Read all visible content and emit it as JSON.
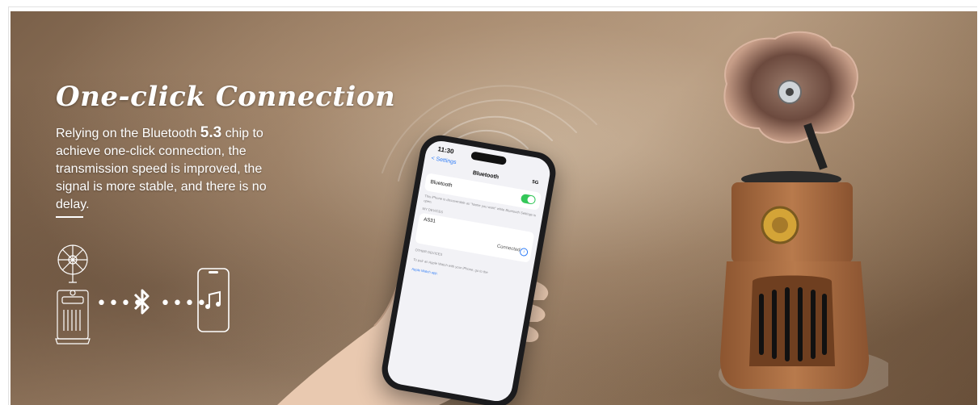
{
  "banner": {
    "headline": "One-click Connection",
    "desc_prefix": "Relying on the Bluetooth ",
    "desc_version": "5.3",
    "desc_suffix": " chip to achieve one-click connection, the transmission speed is improved, the signal is more stable, and there is no delay.",
    "dots": "••••"
  },
  "phone_screen": {
    "time": "11:30",
    "status": "5G",
    "back": "< Settings",
    "title": "Bluetooth",
    "toggle_label": "Bluetooth",
    "toggle_on": true,
    "note": "This iPhone is discoverable as \"Name you want\" while Bluetooth Settings is open.",
    "section_my_devices": "MY DEVICES",
    "device_name": "AS31",
    "device_status": "Connected",
    "section_other": "OTHER DEVICES",
    "pair_note": "To pair an Apple Watch with your iPhone, go to the",
    "pair_link": "Apple Watch app."
  },
  "icons": [
    "gramophone-line-icon",
    "bluetooth-icon",
    "music-note-phone-icon",
    "info-icon"
  ],
  "colors": {
    "text": "#ffffff",
    "toggle_on": "#34c759",
    "ios_blue": "#2f7cf6",
    "wood": "#a86a40",
    "brass": "#d4a437",
    "copper_horn": "#6c4a3e"
  }
}
